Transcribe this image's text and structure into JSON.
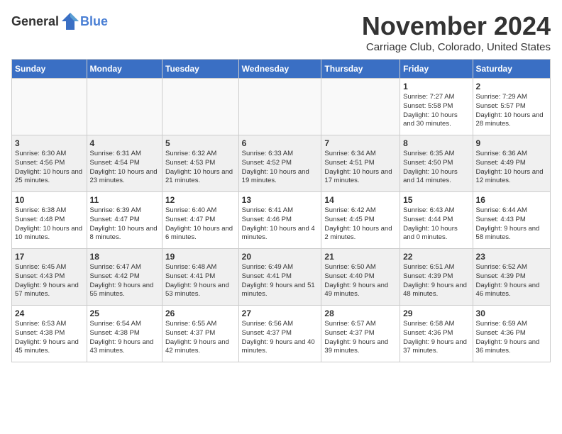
{
  "header": {
    "logo_general": "General",
    "logo_blue": "Blue",
    "title": "November 2024",
    "subtitle": "Carriage Club, Colorado, United States"
  },
  "days_of_week": [
    "Sunday",
    "Monday",
    "Tuesday",
    "Wednesday",
    "Thursday",
    "Friday",
    "Saturday"
  ],
  "weeks": [
    [
      {
        "day": "",
        "info": "",
        "empty": true
      },
      {
        "day": "",
        "info": "",
        "empty": true
      },
      {
        "day": "",
        "info": "",
        "empty": true
      },
      {
        "day": "",
        "info": "",
        "empty": true
      },
      {
        "day": "",
        "info": "",
        "empty": true
      },
      {
        "day": "1",
        "info": "Sunrise: 7:27 AM\nSunset: 5:58 PM\nDaylight: 10 hours and 30 minutes."
      },
      {
        "day": "2",
        "info": "Sunrise: 7:29 AM\nSunset: 5:57 PM\nDaylight: 10 hours and 28 minutes."
      }
    ],
    [
      {
        "day": "3",
        "info": "Sunrise: 6:30 AM\nSunset: 4:56 PM\nDaylight: 10 hours and 25 minutes."
      },
      {
        "day": "4",
        "info": "Sunrise: 6:31 AM\nSunset: 4:54 PM\nDaylight: 10 hours and 23 minutes."
      },
      {
        "day": "5",
        "info": "Sunrise: 6:32 AM\nSunset: 4:53 PM\nDaylight: 10 hours and 21 minutes."
      },
      {
        "day": "6",
        "info": "Sunrise: 6:33 AM\nSunset: 4:52 PM\nDaylight: 10 hours and 19 minutes."
      },
      {
        "day": "7",
        "info": "Sunrise: 6:34 AM\nSunset: 4:51 PM\nDaylight: 10 hours and 17 minutes."
      },
      {
        "day": "8",
        "info": "Sunrise: 6:35 AM\nSunset: 4:50 PM\nDaylight: 10 hours and 14 minutes."
      },
      {
        "day": "9",
        "info": "Sunrise: 6:36 AM\nSunset: 4:49 PM\nDaylight: 10 hours and 12 minutes."
      }
    ],
    [
      {
        "day": "10",
        "info": "Sunrise: 6:38 AM\nSunset: 4:48 PM\nDaylight: 10 hours and 10 minutes."
      },
      {
        "day": "11",
        "info": "Sunrise: 6:39 AM\nSunset: 4:47 PM\nDaylight: 10 hours and 8 minutes."
      },
      {
        "day": "12",
        "info": "Sunrise: 6:40 AM\nSunset: 4:47 PM\nDaylight: 10 hours and 6 minutes."
      },
      {
        "day": "13",
        "info": "Sunrise: 6:41 AM\nSunset: 4:46 PM\nDaylight: 10 hours and 4 minutes."
      },
      {
        "day": "14",
        "info": "Sunrise: 6:42 AM\nSunset: 4:45 PM\nDaylight: 10 hours and 2 minutes."
      },
      {
        "day": "15",
        "info": "Sunrise: 6:43 AM\nSunset: 4:44 PM\nDaylight: 10 hours and 0 minutes."
      },
      {
        "day": "16",
        "info": "Sunrise: 6:44 AM\nSunset: 4:43 PM\nDaylight: 9 hours and 58 minutes."
      }
    ],
    [
      {
        "day": "17",
        "info": "Sunrise: 6:45 AM\nSunset: 4:43 PM\nDaylight: 9 hours and 57 minutes."
      },
      {
        "day": "18",
        "info": "Sunrise: 6:47 AM\nSunset: 4:42 PM\nDaylight: 9 hours and 55 minutes."
      },
      {
        "day": "19",
        "info": "Sunrise: 6:48 AM\nSunset: 4:41 PM\nDaylight: 9 hours and 53 minutes."
      },
      {
        "day": "20",
        "info": "Sunrise: 6:49 AM\nSunset: 4:41 PM\nDaylight: 9 hours and 51 minutes."
      },
      {
        "day": "21",
        "info": "Sunrise: 6:50 AM\nSunset: 4:40 PM\nDaylight: 9 hours and 49 minutes."
      },
      {
        "day": "22",
        "info": "Sunrise: 6:51 AM\nSunset: 4:39 PM\nDaylight: 9 hours and 48 minutes."
      },
      {
        "day": "23",
        "info": "Sunrise: 6:52 AM\nSunset: 4:39 PM\nDaylight: 9 hours and 46 minutes."
      }
    ],
    [
      {
        "day": "24",
        "info": "Sunrise: 6:53 AM\nSunset: 4:38 PM\nDaylight: 9 hours and 45 minutes."
      },
      {
        "day": "25",
        "info": "Sunrise: 6:54 AM\nSunset: 4:38 PM\nDaylight: 9 hours and 43 minutes."
      },
      {
        "day": "26",
        "info": "Sunrise: 6:55 AM\nSunset: 4:37 PM\nDaylight: 9 hours and 42 minutes."
      },
      {
        "day": "27",
        "info": "Sunrise: 6:56 AM\nSunset: 4:37 PM\nDaylight: 9 hours and 40 minutes."
      },
      {
        "day": "28",
        "info": "Sunrise: 6:57 AM\nSunset: 4:37 PM\nDaylight: 9 hours and 39 minutes."
      },
      {
        "day": "29",
        "info": "Sunrise: 6:58 AM\nSunset: 4:36 PM\nDaylight: 9 hours and 37 minutes."
      },
      {
        "day": "30",
        "info": "Sunrise: 6:59 AM\nSunset: 4:36 PM\nDaylight: 9 hours and 36 minutes."
      }
    ]
  ]
}
